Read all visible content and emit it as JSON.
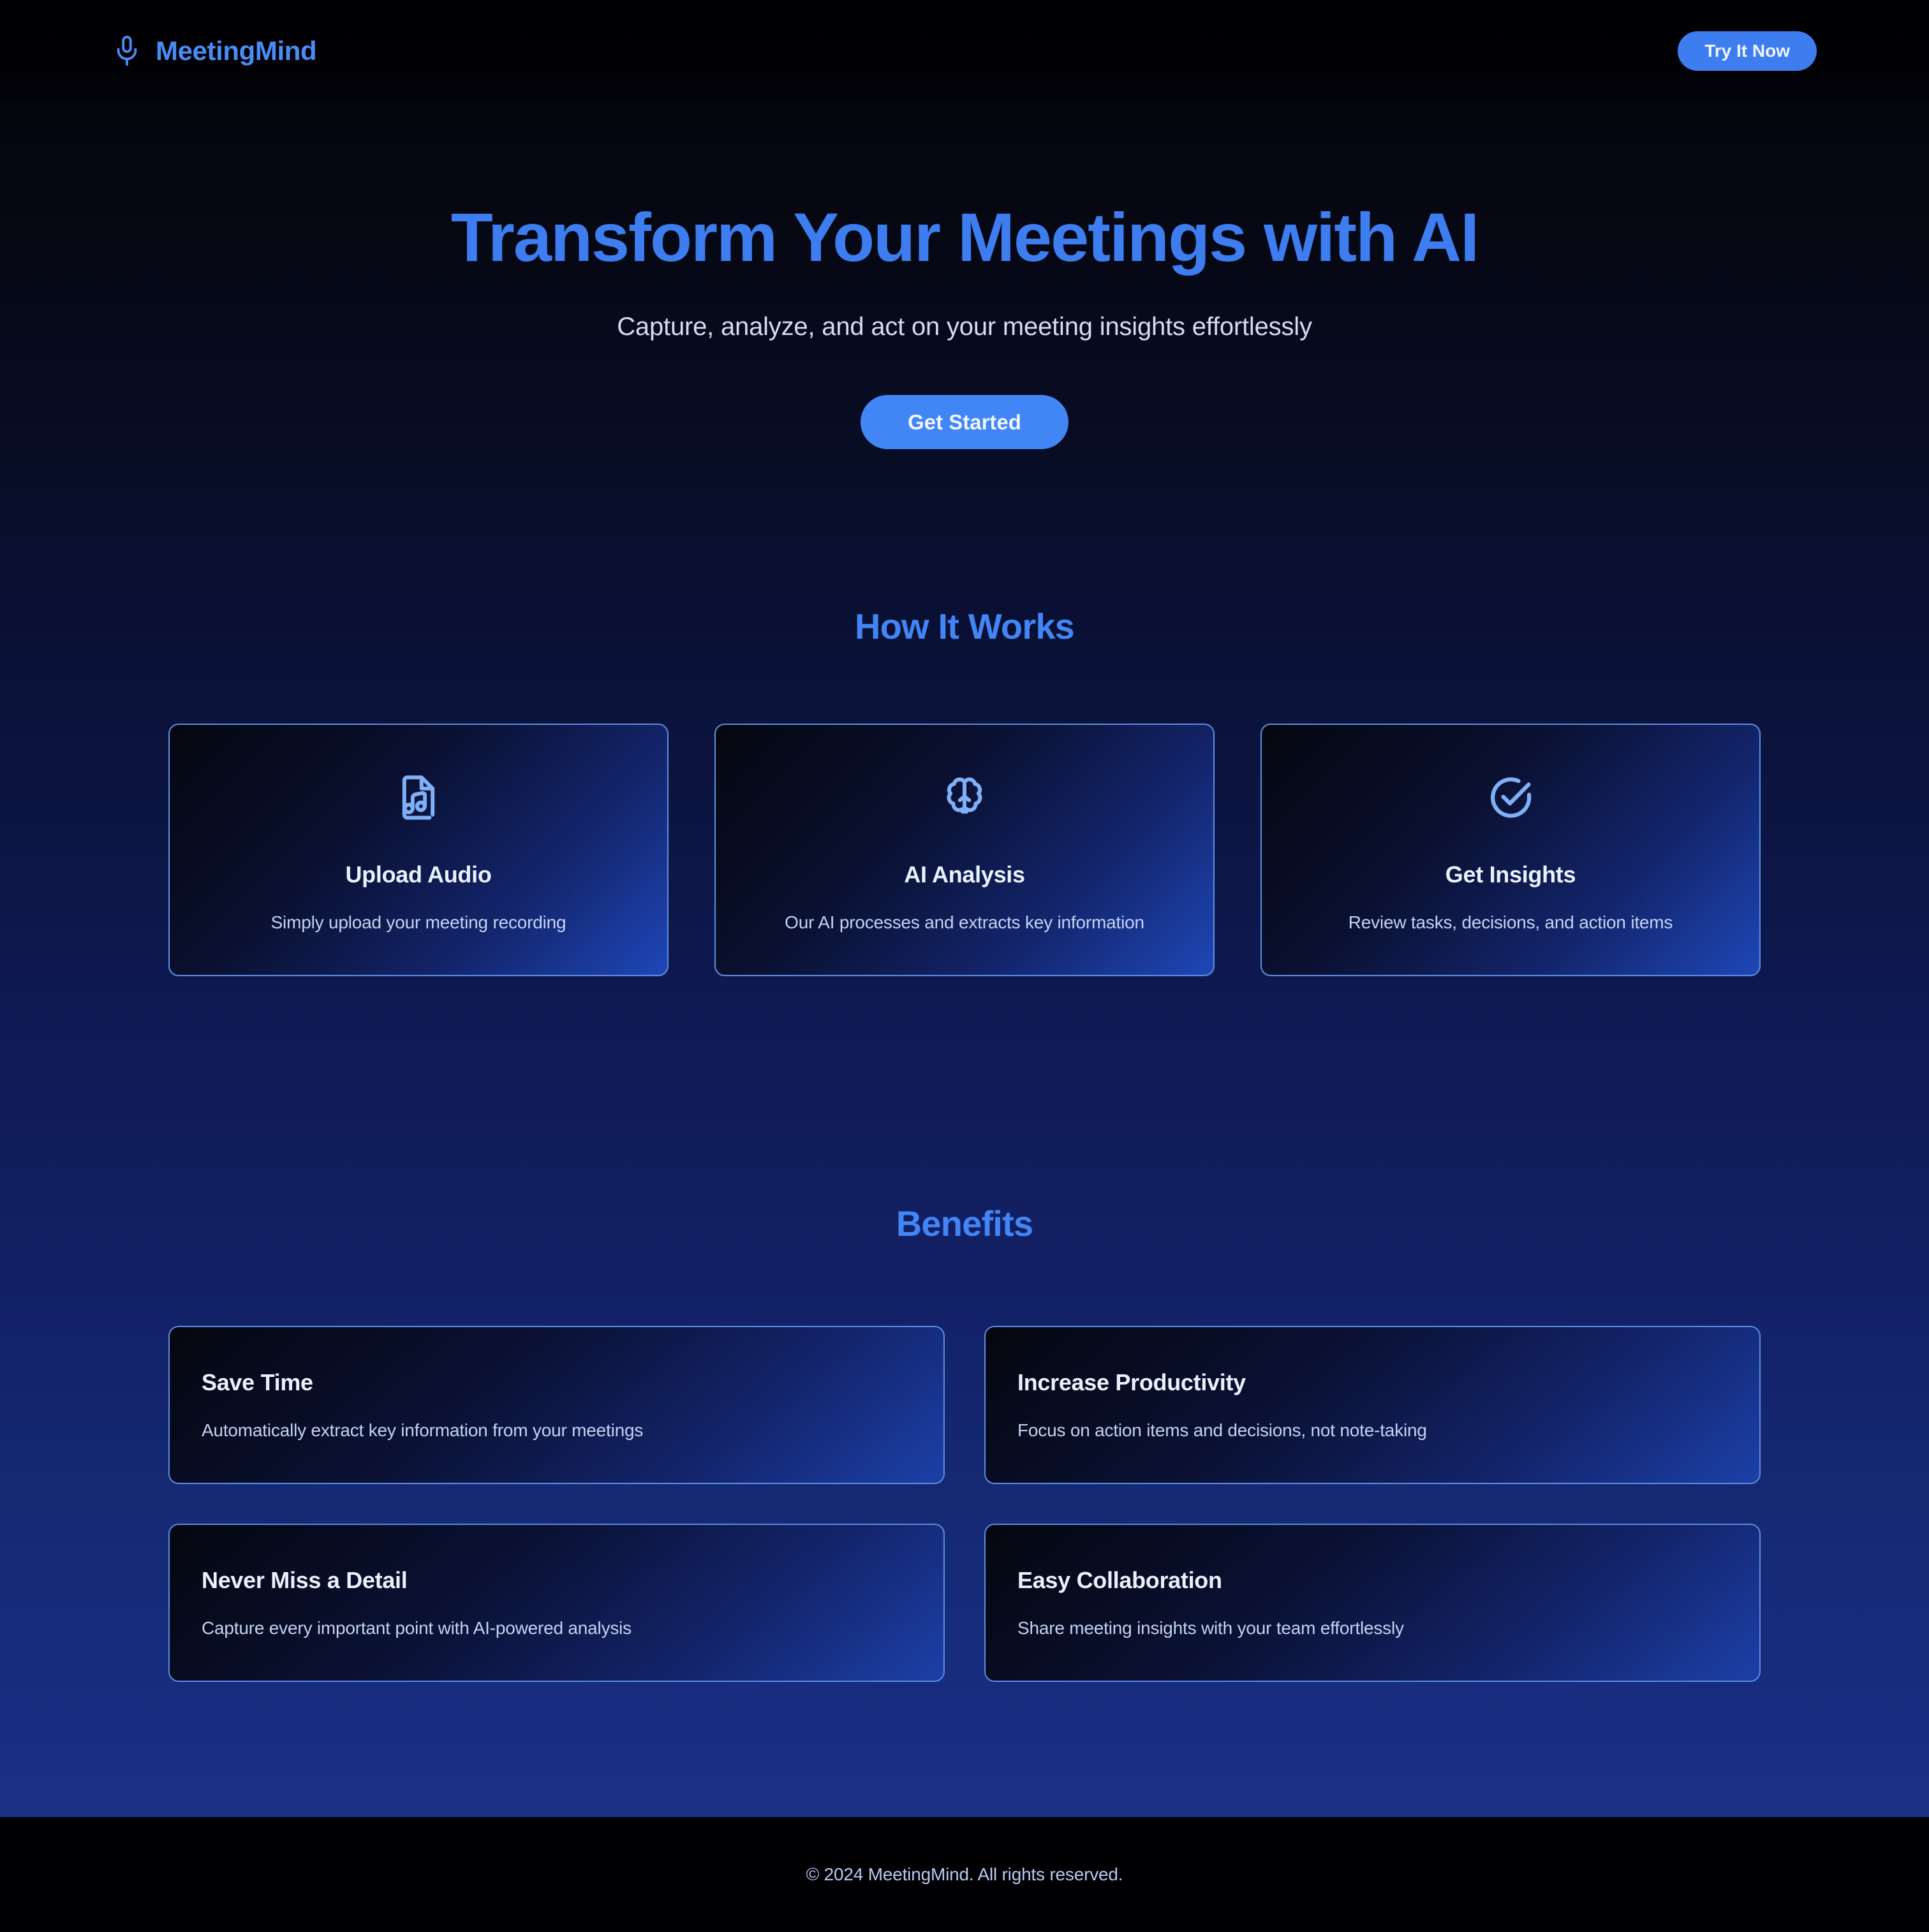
{
  "header": {
    "brand_name": "MeetingMind",
    "brand_icon": "microphone-icon",
    "cta_label": "Try It Now"
  },
  "hero": {
    "title": "Transform Your Meetings with AI",
    "subtitle": "Capture, analyze, and act on your meeting insights effortlessly",
    "cta_label": "Get Started"
  },
  "how_it_works": {
    "title": "How It Works",
    "cards": [
      {
        "icon": "file-audio-icon",
        "title": "Upload Audio",
        "desc": "Simply upload your meeting recording"
      },
      {
        "icon": "brain-icon",
        "title": "AI Analysis",
        "desc": "Our AI processes and extracts key information"
      },
      {
        "icon": "circle-check-icon",
        "title": "Get Insights",
        "desc": "Review tasks, decisions, and action items"
      }
    ]
  },
  "benefits": {
    "title": "Benefits",
    "cards": [
      {
        "title": "Save Time",
        "desc": "Automatically extract key information from your meetings"
      },
      {
        "title": "Increase Productivity",
        "desc": "Focus on action items and decisions, not note-taking"
      },
      {
        "title": "Never Miss a Detail",
        "desc": "Capture every important point with AI-powered analysis"
      },
      {
        "title": "Easy Collaboration",
        "desc": "Share meeting insights with your team effortlessly"
      }
    ]
  },
  "footer": {
    "copyright": "© 2024 MeetingMind. All rights reserved."
  },
  "colors": {
    "accent_blue": "#4285f4",
    "brand_blue": "#4a8cf5",
    "card_border": "#5b8de0",
    "heading_light": "#eaf1fd",
    "body_text": "#c3d3f2",
    "page_bg_top": "#030308",
    "page_bg_bottom": "#1a3185",
    "footer_bg": "#000003"
  }
}
